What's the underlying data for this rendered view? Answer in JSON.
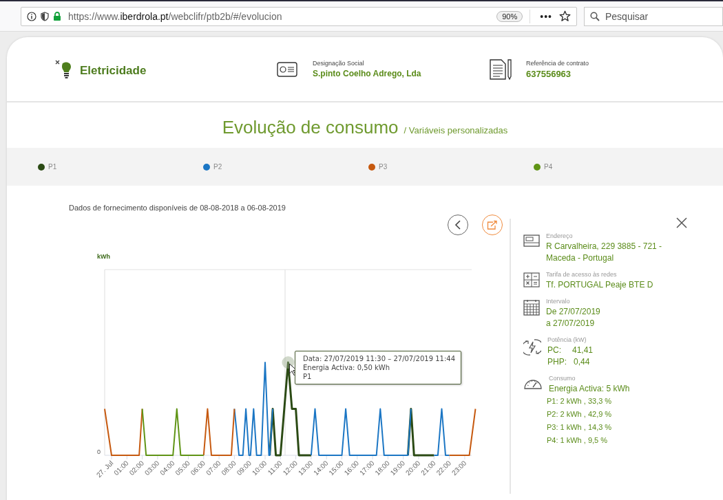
{
  "browser": {
    "url": "https://www.**iberdrola.pt**/webclifr/ptb2b/#/evolucion",
    "zoom": "90%",
    "menu": "•••",
    "search_placeholder": "Pesquisar"
  },
  "header": {
    "product": "Eletricidade",
    "company_label": "Designação Social",
    "company": "S.pinto Coelho Adrego, Lda",
    "contract_label": "Referência de contrato",
    "contract": "637556963"
  },
  "title": "Evolução de consumo",
  "subtitle": "/ Variáveis personalizadas",
  "legend": [
    {
      "label": "P1",
      "color": "#2b4a14"
    },
    {
      "label": "P2",
      "color": "#1b76c4"
    },
    {
      "label": "P3",
      "color": "#c6590f"
    },
    {
      "label": "P4",
      "color": "#5f9415"
    }
  ],
  "supply_note": "Dados de fornecimento disponíveis de 08-08-2018 a 06-08-2019",
  "chart": {
    "ylabel": "kWh",
    "y_tick": "0",
    "x_ticks": [
      "27. Jul",
      "01:00",
      "02:00",
      "03:00",
      "04:00",
      "05:00",
      "06:00",
      "07:00",
      "08:00",
      "09:00",
      "10:00",
      "11:00",
      "12:00",
      "13:00",
      "14:00",
      "15:00",
      "16:00",
      "17:00",
      "18:00",
      "19:00",
      "20:00",
      "21:00",
      "22:00",
      "23:00"
    ],
    "tooltip": [
      "Data: 27/07/2019 11:30 – 27/07/2019 11:44",
      "Energia Activa: 0,50 kWh",
      "P1"
    ]
  },
  "details": [
    {
      "kind": "address",
      "label": "Endereço",
      "lines": [
        "R Carvalheira, 229 3885 - 721 -",
        "Maceda - Portugal"
      ]
    },
    {
      "kind": "tariff",
      "label": "Tarifa de acesso às redes",
      "lines": [
        "Tf. PORTUGAL Peaje BTE D"
      ]
    },
    {
      "kind": "interval",
      "label": "Intervalo",
      "lines": [
        "De 27/07/2019",
        "a 27/07/2019"
      ]
    },
    {
      "kind": "power",
      "label": "Potência (kW)",
      "pairs": [
        {
          "name": "PC:",
          "value": "41,41"
        },
        {
          "name": "PHP:",
          "value": "0,44"
        }
      ]
    },
    {
      "kind": "consumption",
      "label": "Consumo",
      "lines": [
        "Energia Activa: 5 kWh"
      ],
      "sublines": [
        "P1: 2 kWh , 33,3 %",
        "P2: 2 kWh , 42,9 %",
        "P3: 1 kWh , 14,3 %",
        "P4: 1 kWh , 9,5 %"
      ]
    }
  ]
}
